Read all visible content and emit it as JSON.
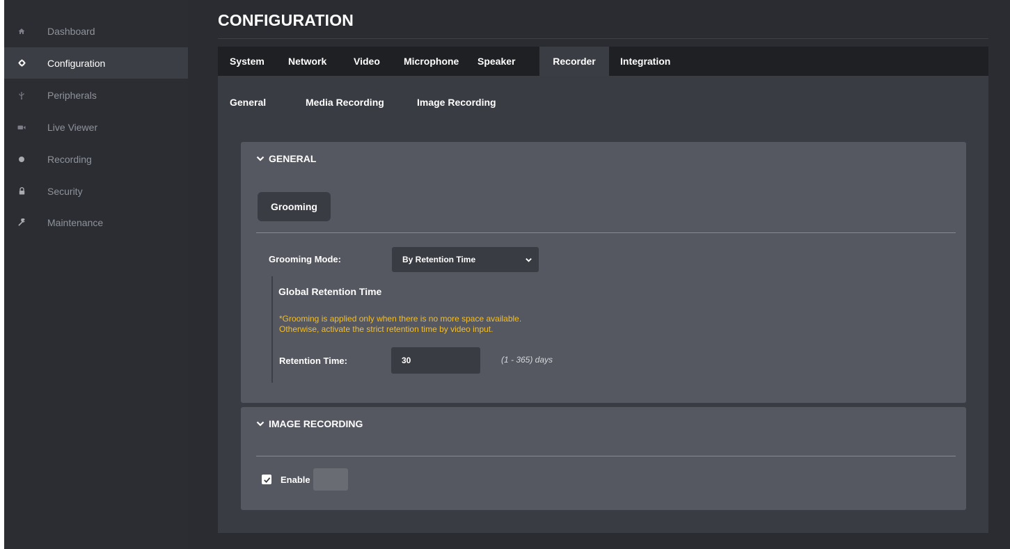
{
  "sidebar": {
    "items": [
      {
        "label": "Dashboard",
        "icon": "home-icon",
        "active": false
      },
      {
        "label": "Configuration",
        "icon": "gear-icon",
        "active": true
      },
      {
        "label": "Peripherals",
        "icon": "usb-icon",
        "active": false
      },
      {
        "label": "Live Viewer",
        "icon": "video-camera-icon",
        "active": false
      },
      {
        "label": "Recording",
        "icon": "record-dot-icon",
        "active": false
      },
      {
        "label": "Security",
        "icon": "lock-icon",
        "active": false
      },
      {
        "label": "Maintenance",
        "icon": "wrench-icon",
        "active": false
      }
    ]
  },
  "page": {
    "title": "CONFIGURATION"
  },
  "tabs": [
    {
      "label": "System"
    },
    {
      "label": "Network"
    },
    {
      "label": "Video"
    },
    {
      "label": "Microphone"
    },
    {
      "label": "Speaker"
    },
    {
      "label": "Recorder",
      "active": true
    },
    {
      "label": "Integration"
    }
  ],
  "subtabs": [
    {
      "label": "General"
    },
    {
      "label": "Media Recording"
    },
    {
      "label": "Image Recording",
      "active": true
    }
  ],
  "general_section": {
    "header": "GENERAL",
    "grooming_button": "Grooming",
    "grooming_mode_label": "Grooming Mode:",
    "grooming_mode_value": "By Retention Time",
    "global_retention_title": "Global Retention Time",
    "warning_line1": "*Grooming is applied only when there is no more space available.",
    "warning_line2": "Otherwise, activate the strict retention time by video input.",
    "retention_label": "Retention Time:",
    "retention_value": "30",
    "retention_range": "(1 - 365)  days"
  },
  "image_recording_section": {
    "header": "IMAGE RECORDING",
    "enable_label": "Enable",
    "enable_checked": true
  },
  "colors": {
    "background": "#2a2c31",
    "card": "#555761",
    "warning": "#f2bf2d",
    "tab_bar": "#1f2024"
  }
}
